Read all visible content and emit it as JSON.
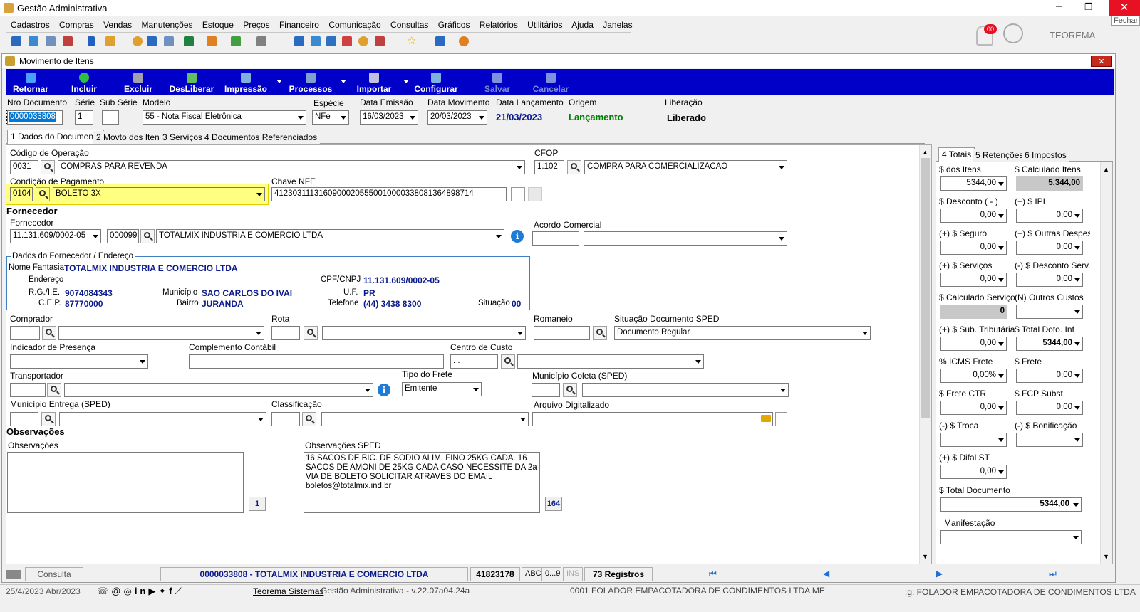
{
  "app": {
    "title": "Gestão Administrativa",
    "close_tooltip": "Fechar",
    "brand": "TEOREMA",
    "notif_count": "00"
  },
  "menu": [
    "Cadastros",
    "Compras",
    "Vendas",
    "Manutenções",
    "Estoque",
    "Preços",
    "Financeiro",
    "Comunicação",
    "Consultas",
    "Gráficos",
    "Relatórios",
    "Utilitários",
    "Ajuda",
    "Janelas"
  ],
  "window": {
    "title": "Movimento de Itens"
  },
  "toolbar": {
    "retornar": "Retornar",
    "incluir": "Incluir",
    "excluir": "Excluir",
    "desliberar": "DesLiberar",
    "impressao": "Impressão",
    "processos": "Processos",
    "importar": "Importar",
    "configurar": "Configurar",
    "salvar": "Salvar",
    "cancelar": "Cancelar"
  },
  "header": {
    "nro_documento_label": "Nro Documento",
    "nro_documento": "0000033808",
    "serie_label": "Série",
    "serie": "1",
    "subserie_label": "Sub Série",
    "subserie": "",
    "modelo_label": "Modelo",
    "modelo": "55 - Nota Fiscal Eletrônica",
    "especie_label": "Espécie",
    "especie": "NFe",
    "data_emissao_label": "Data Emissão",
    "data_emissao": "16/03/2023",
    "data_movimento_label": "Data Movimento",
    "data_movimento": "20/03/2023",
    "data_lancamento_label": "Data Lançamento",
    "data_lancamento": "21/03/2023",
    "origem_label": "Origem",
    "origem": "Lançamento",
    "liberacao_label": "Liberação",
    "liberacao": "Liberado"
  },
  "tabs": [
    "1 Dados do Documento",
    "2 Movto dos Itens",
    "3 Serviços",
    "4 Documentos Referenciados"
  ],
  "form": {
    "cod_operacao_label": "Código de Operação",
    "cod_operacao": "0031",
    "cod_operacao_desc": "COMPRAS PARA REVENDA",
    "cfop_label": "CFOP",
    "cfop": "1.102",
    "cfop_desc": "COMPRA PARA COMERCIALIZACAO",
    "cond_pag_label": "Condição de Pagamento",
    "cond_pag": "0104",
    "cond_pag_desc": "BOLETO 3X",
    "chave_nfe_label": "Chave NFE",
    "chave_nfe": "41230311131609000205550010000338081364898714",
    "fornecedor_section": "Fornecedor",
    "fornecedor_label": "Fornecedor",
    "fornecedor_cnpj": "11.131.609/0002-05",
    "fornecedor_cod": "0000995",
    "fornecedor_nome": "TOTALMIX INDUSTRIA E COMERCIO LTDA",
    "acordo_label": "Acordo Comercial",
    "dados_legend": "Dados do Fornecedor / Endereço",
    "nome_fantasia_label": "Nome Fantasia",
    "nome_fantasia": "TOTALMIX INDUSTRIA E COMERCIO LTDA",
    "endereco_label": "Endereço",
    "cpf_label": "CPF/CNPJ",
    "cpf": "11.131.609/0002-05",
    "rg_label": "R.G./I.E.",
    "rg": "9074084343",
    "municipio_label": "Município",
    "municipio": "SAO CARLOS DO IVAI",
    "uf_label": "U.F.",
    "uf": "PR",
    "cep_label": "C.E.P.",
    "cep": "87770000",
    "bairro_label": "Bairro",
    "bairro": "JURANDA",
    "telefone_label": "Telefone",
    "telefone": "(44) 3438 8300",
    "situacao_label": "Situação",
    "situacao": "00",
    "comprador_label": "Comprador",
    "rota_label": "Rota",
    "romaneio_label": "Romaneio",
    "sit_sped_label": "Situação Documento SPED",
    "sit_sped": "Documento Regular",
    "ind_presenca_label": "Indicador de Presença",
    "compl_contabil_label": "Complemento Contábil",
    "centro_custo_label": "Centro de Custo",
    "centro_custo": " .  .",
    "transportador_label": "Transportador",
    "tipo_frete_label": "Tipo do Frete",
    "tipo_frete": "Emitente",
    "mun_coleta_label": "Município Coleta (SPED)",
    "mun_entrega_label": "Município Entrega (SPED)",
    "classificacao_label": "Classificação",
    "arquivo_label": "Arquivo Digitalizado",
    "obs_section": "Observações",
    "obs_label": "Observações",
    "obs_count": "1",
    "obs_sped_label": "Observações SPED",
    "obs_sped": "16 SACOS DE BIC. DE SODIO ALIM. FINO 25KG CADA. 16 SACOS DE AMONI DE 25KG CADA CASO NECESSITE DA 2a VIA DE BOLETO SOLICITAR ATRAVES DO EMAIL boletos@totalmix.ind.br",
    "obs_sped_count": "164"
  },
  "totals": {
    "tabs": [
      "4 Totais",
      "5 Retenções",
      "6 Impostos"
    ],
    "dos_itens_label": "$ dos Itens",
    "dos_itens": "5344,00",
    "calc_itens_label": "$ Calculado Itens",
    "calc_itens": "5.344,00",
    "desconto_label": "$ Desconto ( - )",
    "desconto": "0,00",
    "ipi_label": "(+) $ IPI",
    "ipi": "0,00",
    "seguro_label": "(+) $ Seguro",
    "seguro": "0,00",
    "outras_label": "(+) $ Outras Despesa",
    "outras": "0,00",
    "servicos_label": "(+) $ Serviços",
    "servicos": "0,00",
    "desc_serv_label": "(-) $ Desconto Serv.",
    "desc_serv": "0,00",
    "calc_serv_label": "$ Calculado Serviços",
    "calc_serv": "0",
    "outros_custos_label": "(N) Outros Custos",
    "outros_custos": "",
    "sub_trib_label": "(+) $ Sub. Tributária",
    "sub_trib": "0,00",
    "total_doto_label": "$ Total Doto. Inf",
    "total_doto": "5344,00",
    "icms_frete_label": "% ICMS Frete",
    "icms_frete": "0,00%",
    "frete_label": "$ Frete",
    "frete": "0,00",
    "frete_ctr_label": "$ Frete CTR",
    "frete_ctr": "0,00",
    "fcp_label": "$ FCP Subst.",
    "fcp": "0,00",
    "troca_label": "(-) $ Troca",
    "troca": "",
    "bonif_label": "(-) $ Bonificação",
    "bonif": "",
    "difal_label": "(+) $ Difal ST",
    "difal": "0,00",
    "total_doc_label": "$ Total Documento",
    "total_doc": "5344,00",
    "manifestacao_label": "Manifestação",
    "manifestacao": ""
  },
  "status": {
    "mode": "Consulta",
    "doc": "0000033808 - TOTALMIX INDUSTRIA E COMERCIO LTDA",
    "num": "41823178",
    "abc": "ABC",
    "range": "0...9",
    "ins": "INS",
    "registros": "73 Registros"
  },
  "footer": {
    "date": "25/4/2023 Abr/2023",
    "teorema": "Teorema Sistemas",
    "version": "Gestão Administrativa - v.22.07a04.24a",
    "company": "0001 FOLADOR EMPACOTADORA DE CONDIMENTOS LTDA ME",
    "company2": ":g: FOLADOR EMPACOTADORA DE CONDIMENTOS LTDA"
  },
  "colors": {
    "toolbar_bg": "#0000c8",
    "highlight": "#ffff80",
    "accent_green": "#008000"
  }
}
